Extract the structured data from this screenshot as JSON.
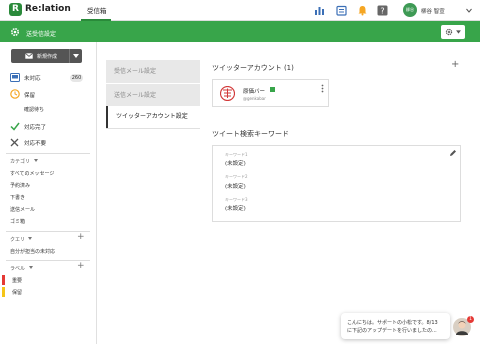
{
  "header": {
    "logo_text": "Re:lation",
    "nav_tab": "受信箱",
    "icons": [
      "chart-icon",
      "calendar-icon",
      "bell-icon",
      "help-icon"
    ],
    "avatar_text": "柳谷",
    "user_name": "柳谷 智宣"
  },
  "page_header": {
    "title": "送受信設定"
  },
  "sidebar": {
    "compose_label": "新規作成",
    "main_items": [
      {
        "label": "未対応",
        "count": "260",
        "icon": "inbox-icon"
      },
      {
        "label": "保留",
        "icon": "clock-icon"
      },
      {
        "label": "確認待ち"
      },
      {
        "label": "対応完了",
        "icon": "check-icon"
      },
      {
        "label": "対応不要",
        "icon": "x-icon"
      }
    ],
    "category_heading": "カテゴリ",
    "category_items": [
      "すべてのメッセージ",
      "予約済み",
      "下書き",
      "送信メール",
      "ゴミ箱"
    ],
    "query_heading": "クエリ",
    "query_items": [
      "自分が担当の未対応"
    ],
    "label_heading": "ラベル",
    "labels": [
      {
        "name": "重要",
        "color": "#e53935"
      },
      {
        "name": "保留",
        "color": "#f5c518"
      }
    ]
  },
  "settings_menu": {
    "items": [
      "受信メール設定",
      "送信メール設定",
      "ツイッターアカウント設定"
    ],
    "active_index": 2
  },
  "twitter": {
    "section_title": "ツイッターアカウント (1)",
    "account_name": "原価バー",
    "account_handle": "@genkabar",
    "keywords_title": "ツイート検索キーワード",
    "keywords": [
      {
        "label": "キーワード1",
        "value": "(未設定)"
      },
      {
        "label": "キーワード2",
        "value": "(未設定)"
      },
      {
        "label": "キーワード3",
        "value": "(未設定)"
      }
    ]
  },
  "chat": {
    "line1": "こんにちは。サポートの小松です。8/13",
    "line2": "に下記のアップデートを行いましたの...",
    "badge": "1"
  },
  "colors": {
    "brand_green": "#38a54a",
    "dark_button": "#555555"
  }
}
